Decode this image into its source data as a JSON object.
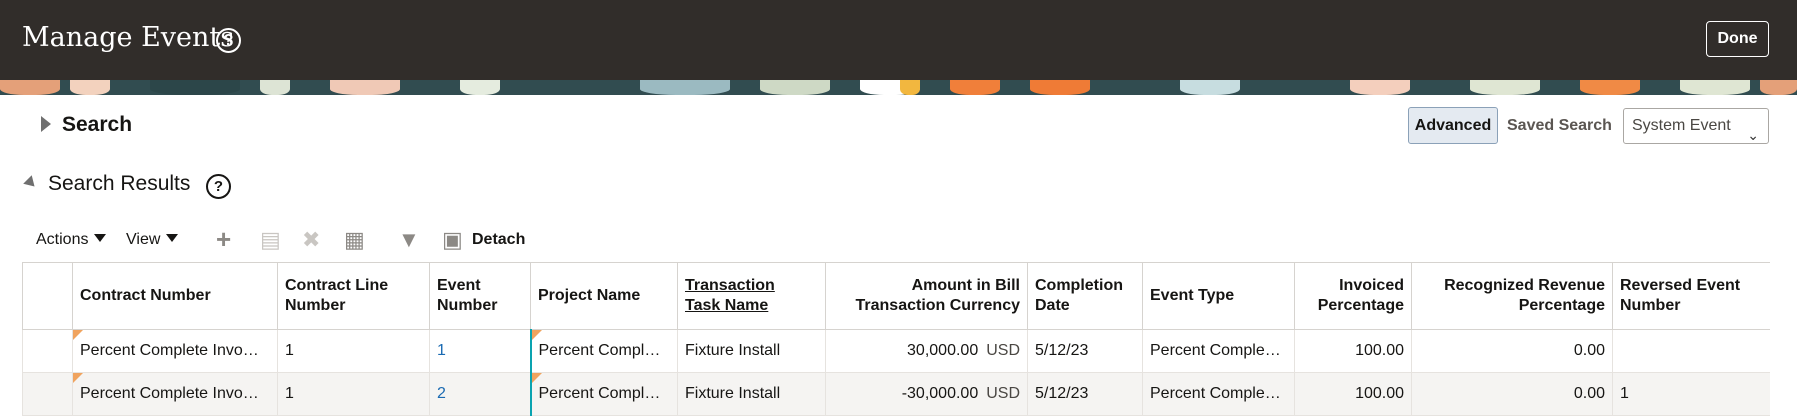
{
  "header": {
    "title": "Manage Events",
    "done_label": "Done"
  },
  "search": {
    "label": "Search",
    "advanced_label": "Advanced",
    "saved_search_label": "Saved Search",
    "saved_search_value": "System Event"
  },
  "results": {
    "label": "Search Results"
  },
  "toolbar": {
    "actions_label": "Actions",
    "view_label": "View",
    "detach_label": "Detach"
  },
  "colors": {
    "topbar": "#312d2a",
    "link": "#1a6ab2",
    "accent": "#0aa3b0",
    "flag": "#f0a35e"
  },
  "icons": [
    "help-icon",
    "add-icon",
    "edit-icon",
    "delete-icon",
    "export-icon",
    "filter-icon",
    "detach-icon"
  ],
  "table": {
    "columns": {
      "contract_number": "Contract Number",
      "contract_line_number_1": "Contract Line",
      "contract_line_number_2": "Number",
      "event_number_1": "Event",
      "event_number_2": "Number",
      "project_name": "Project Name",
      "transaction_task_1": "Transaction",
      "transaction_task_2": "Task Name",
      "amount_1": "Amount in Bill",
      "amount_2": "Transaction Currency",
      "completion_date_1": "Completion",
      "completion_date_2": "Date",
      "event_type": "Event Type",
      "invoiced_1": "Invoiced",
      "invoiced_2": "Percentage",
      "recognized_1": "Recognized Revenue",
      "recognized_2": "Percentage",
      "reversed_1": "Reversed Event",
      "reversed_2": "Number"
    },
    "rows": [
      {
        "contract_number": "Percent Complete Invo…",
        "contract_line_number": "1",
        "event_number": "1",
        "project_name": "Percent Compl…",
        "task_name": "Fixture Install",
        "amount": "30,000.00",
        "currency": "USD",
        "completion_date": "5/12/23",
        "event_type": "Percent Comple…",
        "invoiced_pct": "100.00",
        "recognized_pct": "0.00",
        "reversed_event": ""
      },
      {
        "contract_number": "Percent Complete Invo…",
        "contract_line_number": "1",
        "event_number": "2",
        "project_name": "Percent Compl…",
        "task_name": "Fixture Install",
        "amount": "-30,000.00",
        "currency": "USD",
        "completion_date": "5/12/23",
        "event_type": "Percent Comple…",
        "invoiced_pct": "100.00",
        "recognized_pct": "0.00",
        "reversed_event": "1"
      }
    ]
  }
}
